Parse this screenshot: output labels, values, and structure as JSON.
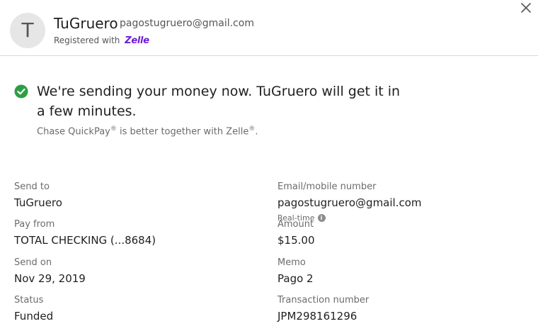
{
  "recipient": {
    "avatar_letter": "T",
    "name": "TuGruero",
    "email": "pagostugruero@gmail.com",
    "registered_label": "Registered with",
    "registered_brand": "Zelle"
  },
  "confirmation": {
    "message": "We're sending your money now. TuGruero will get it in a few minutes.",
    "note_part1": "Chase QuickPay",
    "note_sup1": "®",
    "note_part2": " is better together with Zelle",
    "note_sup2": "®",
    "note_part3": "."
  },
  "details": {
    "send_to_label": "Send to",
    "send_to_value": "TuGruero",
    "email_label": "Email/mobile number",
    "email_value": "pagostugruero@gmail.com",
    "realtime_label": "Real-time",
    "pay_from_label": "Pay from",
    "pay_from_value": "TOTAL CHECKING (...8684)",
    "amount_label": "Amount",
    "amount_value": "$15.00",
    "send_on_label": "Send on",
    "send_on_value": "Nov 29, 2019",
    "memo_label": "Memo",
    "memo_value": "Pago 2",
    "status_label": "Status",
    "status_value": "Funded",
    "transaction_label": "Transaction number",
    "transaction_value": "JPM298161296"
  },
  "colors": {
    "success_green": "#2e9e44",
    "zelle_purple": "#6d1ed4",
    "divider": "#d9d9d9"
  },
  "icons": {
    "close": "close-icon",
    "check": "check-circle-icon",
    "info": "info-icon"
  }
}
